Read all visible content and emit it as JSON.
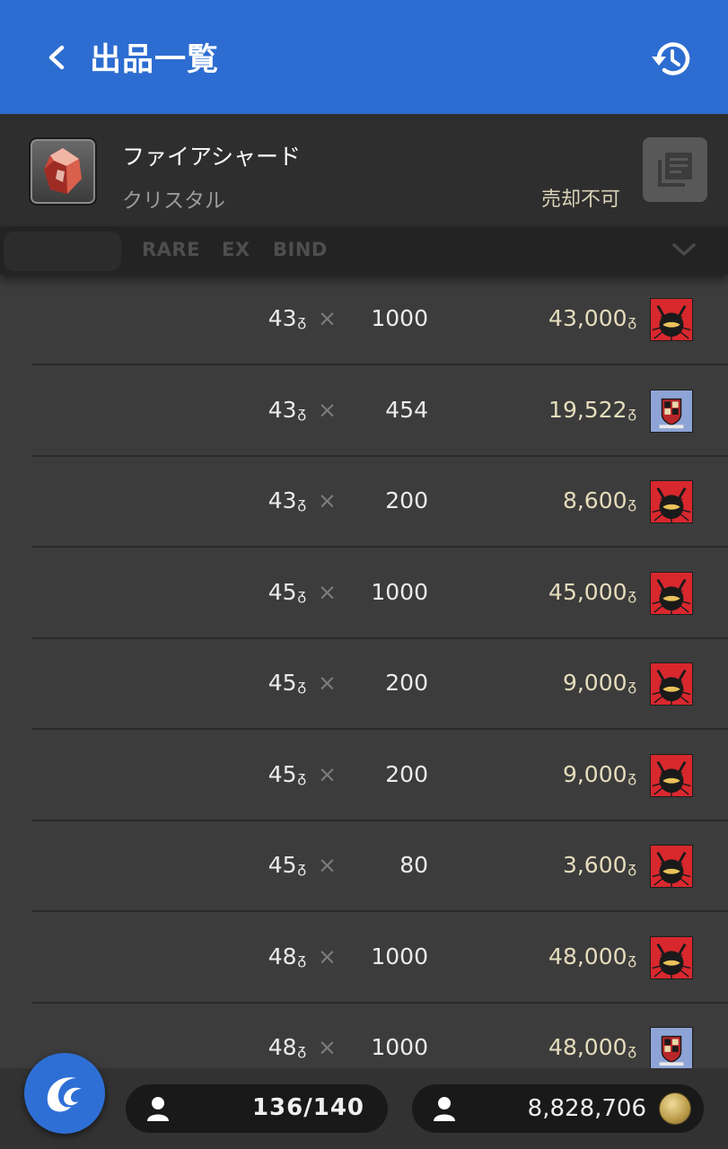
{
  "header": {
    "title": "出品一覧",
    "back_icon": "chevron-left-icon",
    "history_icon": "history-icon",
    "color": "#2d6dd1"
  },
  "item": {
    "name": "ファイアシャード",
    "category": "クリスタル",
    "status": "売却不可",
    "icon": "fire-shard-icon",
    "detail_icon": "item-detail-icon"
  },
  "filter": {
    "tags": [
      "RARE",
      "EX",
      "BIND"
    ],
    "chevron_icon": "chevron-down-icon"
  },
  "currency_symbol": "ᵹ",
  "listings": [
    {
      "unit_price": "43",
      "quantity": "1000",
      "total": "43,000",
      "company": "maelstrom"
    },
    {
      "unit_price": "43",
      "quantity": "454",
      "total": "19,522",
      "company": "immortal-flames"
    },
    {
      "unit_price": "43",
      "quantity": "200",
      "total": "8,600",
      "company": "maelstrom"
    },
    {
      "unit_price": "45",
      "quantity": "1000",
      "total": "45,000",
      "company": "maelstrom"
    },
    {
      "unit_price": "45",
      "quantity": "200",
      "total": "9,000",
      "company": "maelstrom"
    },
    {
      "unit_price": "45",
      "quantity": "200",
      "total": "9,000",
      "company": "maelstrom"
    },
    {
      "unit_price": "45",
      "quantity": "80",
      "total": "3,600",
      "company": "maelstrom"
    },
    {
      "unit_price": "48",
      "quantity": "1000",
      "total": "48,000",
      "company": "maelstrom"
    },
    {
      "unit_price": "48",
      "quantity": "1000",
      "total": "48,000",
      "company": "immortal-flames"
    }
  ],
  "footer": {
    "retainer_slots": "136/140",
    "gil": "8,828,706",
    "person_icon": "person-icon",
    "coin_icon": "gil-coin-icon",
    "fab_icon": "companion-app-icon"
  }
}
